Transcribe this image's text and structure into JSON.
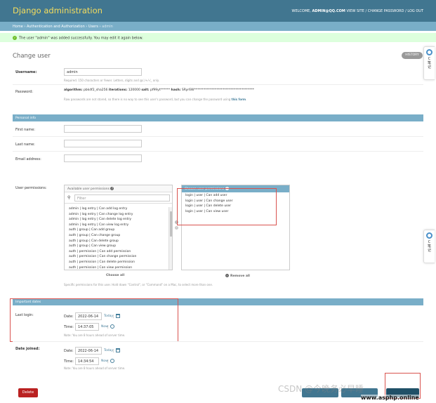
{
  "header": {
    "brand": "Django administration",
    "welcome": "WELCOME,",
    "user": "ADMIN@QQ.COM",
    "view_site": "VIEW SITE",
    "change_password": "CHANGE PASSWORD",
    "logout": "LOG OUT",
    "sep": "/"
  },
  "breadcrumbs": {
    "home": "Home",
    "app": "Authentication and Authorization",
    "model": "Users",
    "current": "admin",
    "sep": "›"
  },
  "message": "The user \"admin\" was added successfully. You may edit it again below.",
  "page": {
    "title": "Change user",
    "history": "HISTORY"
  },
  "side_widget": {
    "letter": "C",
    "text1": "笔",
    "text2": "记"
  },
  "username": {
    "label": "Username:",
    "value": "admin",
    "help": "Required. 150 characters or fewer. Letters, digits and @/./+/-/_ only."
  },
  "password": {
    "label": "Password:",
    "algorithm_label": "algorithm:",
    "algorithm": "pbkdf2_sha256",
    "iterations_label": "iterations:",
    "iterations": "120000",
    "salt_label": "salt:",
    "salt": "pf99yt******",
    "hash_label": "hash:",
    "hash": "SRyr6W**************************************",
    "help": "Raw passwords are not stored, so there is no way to see this user's password, but you can change the password using",
    "help_link": "this form",
    "help_end": "."
  },
  "personal": {
    "title": "Personal info",
    "first_name": "First name:",
    "last_name": "Last name:",
    "email": "Email address:"
  },
  "permissions": {
    "label": "User permissions:",
    "available_title": "Available user permissions",
    "chosen_title": "Chosen user permissions",
    "filter_placeholder": "Filter",
    "available": [
      "admin | log entry | Can add log entry",
      "admin | log entry | Can change log entry",
      "admin | log entry | Can delete log entry",
      "admin | log entry | Can view log entry",
      "auth | group | Can add group",
      "auth | group | Can change group",
      "auth | group | Can delete group",
      "auth | group | Can view group",
      "auth | permission | Can add permission",
      "auth | permission | Can change permission",
      "auth | permission | Can delete permission",
      "auth | permission | Can view permission"
    ],
    "chosen": [
      "login | user | Can add user",
      "login | user | Can change user",
      "login | user | Can delete user",
      "login | user | Can view user"
    ],
    "choose_all": "Choose all",
    "remove_all": "Remove all",
    "help": "Specific permissions for this user. Hold down \"Control\", or \"Command\" on a Mac, to select more than one."
  },
  "dates": {
    "title": "Important dates",
    "last_login": "Last login:",
    "date_joined": "Date joined:",
    "date_label": "Date:",
    "time_label": "Time:",
    "today": "Today",
    "now": "Now",
    "sep": "|",
    "last_login_date": "2022-06-14",
    "last_login_time": "14:37:05",
    "date_joined_date": "2022-06-14",
    "date_joined_time": "14:34:54",
    "note": "Note: You are 8 hours ahead of server time."
  },
  "buttons": {
    "delete": "Delete"
  },
  "watermark": "CSDN @今晚务必早睡",
  "site": "www.asphp.online"
}
